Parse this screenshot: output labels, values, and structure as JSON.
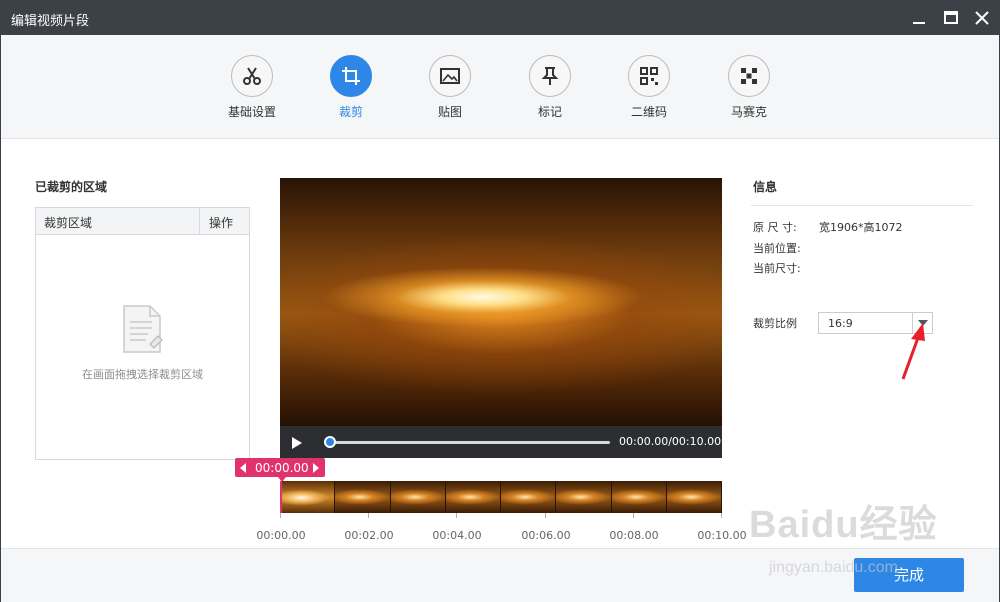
{
  "window": {
    "title": "编辑视频片段"
  },
  "toolbar": {
    "tools": [
      {
        "label": "基础设置",
        "icon": "scissors-icon"
      },
      {
        "label": "裁剪",
        "icon": "crop-icon"
      },
      {
        "label": "贴图",
        "icon": "image-icon"
      },
      {
        "label": "标记",
        "icon": "pin-icon"
      },
      {
        "label": "二维码",
        "icon": "qrcode-icon"
      },
      {
        "label": "马赛克",
        "icon": "mosaic-icon"
      }
    ],
    "active": "裁剪"
  },
  "left_panel": {
    "title": "已裁剪的区域",
    "columns": [
      "裁剪区域",
      "操作"
    ],
    "empty_text": "在画面拖拽选择裁剪区域"
  },
  "player": {
    "timecode": "00:00.00/00:10.00",
    "progress": 0.0
  },
  "timeline": {
    "marker": "00:00.00",
    "ticks": [
      "00:00.00",
      "00:02.00",
      "00:04.00",
      "00:06.00",
      "00:08.00",
      "00:10.00"
    ]
  },
  "info": {
    "title": "信息",
    "original_size_label": "原 尺 寸:",
    "original_size_value": "宽1906*高1072",
    "current_position_label": "当前位置:",
    "current_size_label": "当前尺寸:",
    "ratio_label": "裁剪比例",
    "ratio_value": "16:9"
  },
  "footer": {
    "done_label": "完成"
  },
  "watermark": {
    "logo": "Baidu经验",
    "url": "jingyan.baidu.com"
  },
  "colors": {
    "accent": "#2e87e6",
    "marker": "#e0336c",
    "titlebar": "#3c4047",
    "annotation": "#e8202a"
  }
}
